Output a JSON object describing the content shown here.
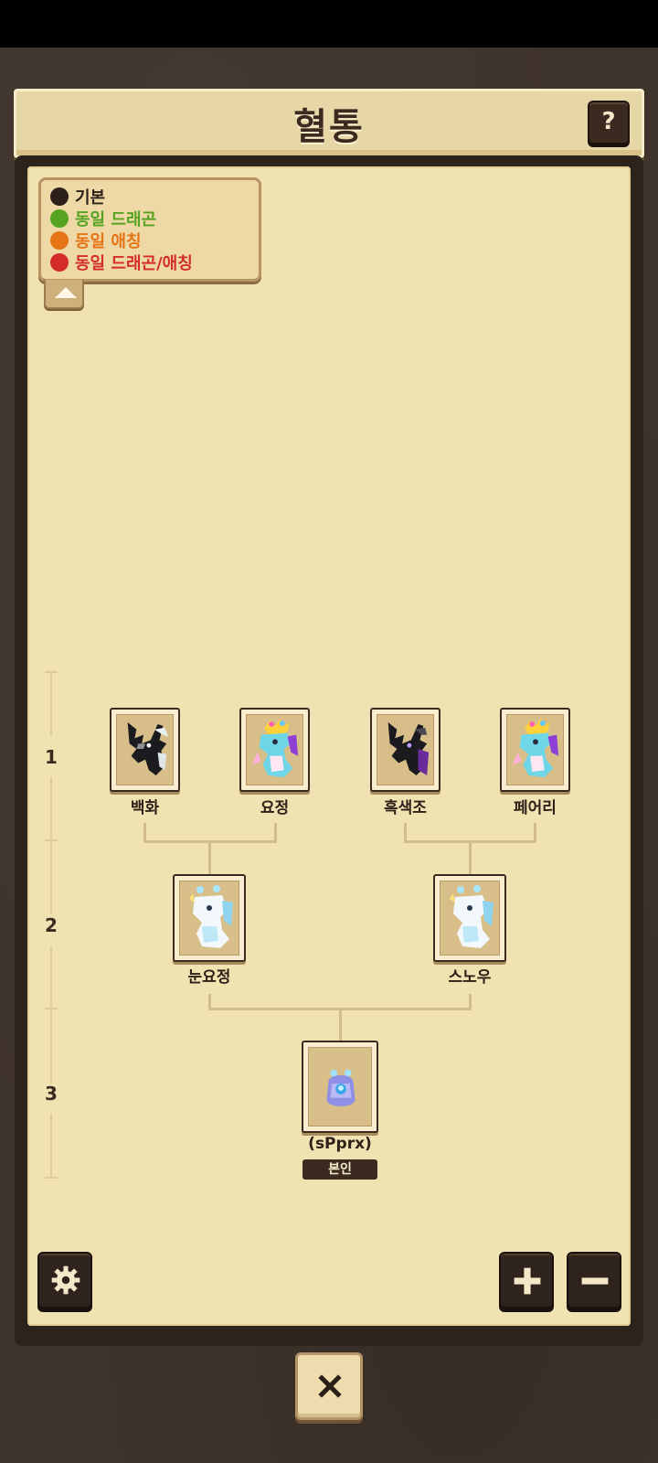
{
  "header": {
    "title": "혈통",
    "help_label": "?"
  },
  "legend": {
    "items": [
      {
        "label": "기본",
        "color": "#2c211a"
      },
      {
        "label": "동일 드래곤",
        "color": "#55a320"
      },
      {
        "label": "동일 애칭",
        "color": "#e67316"
      },
      {
        "label": "동일 드래곤/애칭",
        "color": "#d42b2b"
      }
    ]
  },
  "generations": [
    "1",
    "2",
    "3"
  ],
  "tree": {
    "gen1": [
      {
        "name": "백화",
        "dragon": "black-white-dragon"
      },
      {
        "name": "요정",
        "dragon": "fairy-dragon"
      },
      {
        "name": "흑색조",
        "dragon": "black-purple-dragon"
      },
      {
        "name": "페어리",
        "dragon": "fairy-dragon"
      }
    ],
    "gen2": [
      {
        "name": "눈요정",
        "dragon": "snow-fairy-dragon"
      },
      {
        "name": "스노우",
        "dragon": "snow-fairy-dragon"
      }
    ],
    "gen3": {
      "name": "(sPprx)",
      "dragon": "egg",
      "badge": "본인"
    }
  },
  "controls": {
    "settings_icon": "gear-icon",
    "zoom_in_icon": "plus-icon",
    "zoom_out_icon": "minus-icon",
    "close_icon": "close-icon"
  }
}
